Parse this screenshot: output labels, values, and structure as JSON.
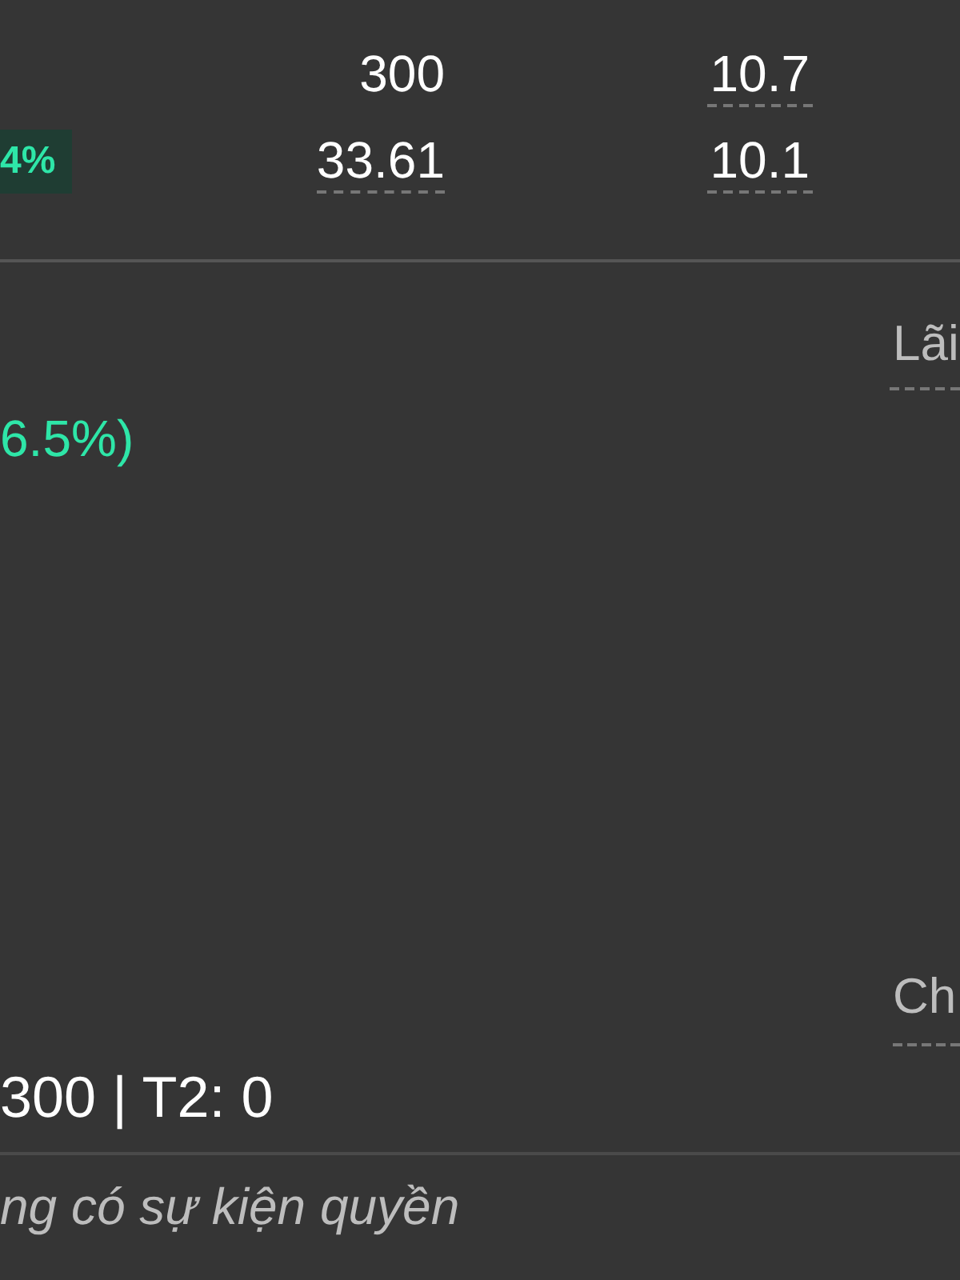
{
  "quote_rows": [
    {
      "change_badge": "",
      "volume": "300",
      "volume_underlined": false,
      "price": "10.7"
    },
    {
      "change_badge": "4%",
      "volume": "33.61",
      "volume_underlined": true,
      "price": "10.1"
    }
  ],
  "summary": {
    "right_label": "Lãi",
    "change": "6.5%)",
    "right_label_2": "Ch",
    "totals": "300 | T2: 0"
  },
  "footer_note": "ng có sự kiện quyền"
}
